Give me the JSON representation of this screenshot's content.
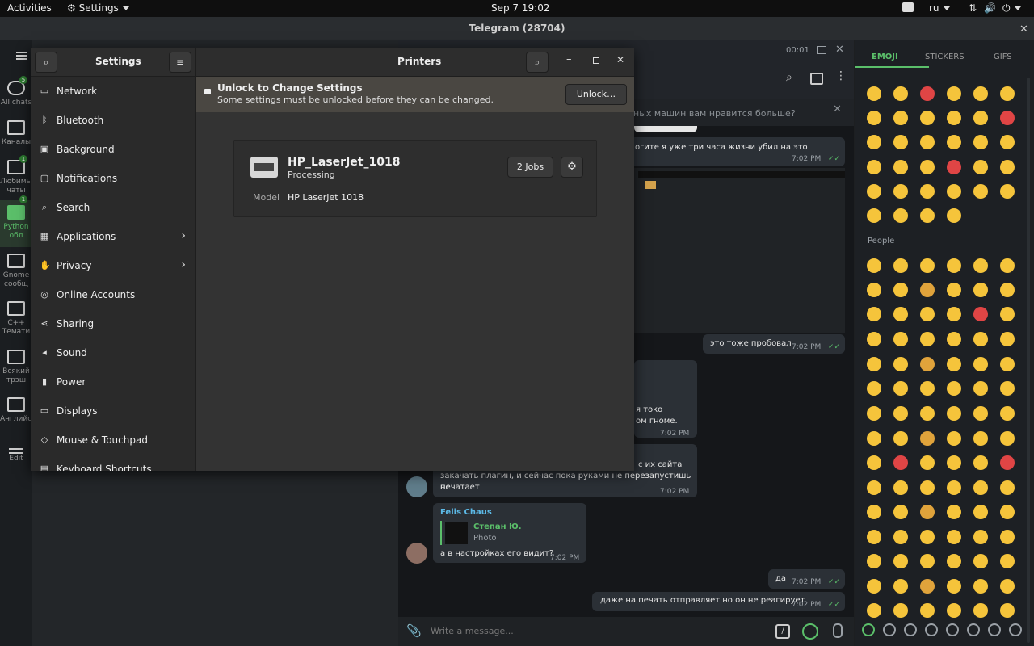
{
  "topbar": {
    "activities": "Activities",
    "app_menu": "Settings",
    "clock": "Sep 7  19:02",
    "lang": "ru"
  },
  "telegram": {
    "title": "Telegram (28704)",
    "folders": [
      {
        "label": "All chats",
        "badge": "5"
      },
      {
        "label": "Каналы",
        "badge": ""
      },
      {
        "label": "Любимые чаты",
        "badge": "1"
      },
      {
        "label": "Python обл",
        "badge": "1"
      },
      {
        "label": "Gnome сообщ",
        "badge": ""
      },
      {
        "label": "C++ Темати",
        "badge": ""
      },
      {
        "label": "Всякий трэш",
        "badge": ""
      },
      {
        "label": "Английский",
        "badge": ""
      },
      {
        "label": "Edit",
        "badge": ""
      }
    ],
    "call_timer": "00:01",
    "pinned_text": "ных машин вам нравится больше?",
    "messages": {
      "m1_text": "огите я уже три часа жизни убил на это",
      "m1_time": "7:02 PM",
      "m2_text": "это тоже пробовал",
      "m2_time": "7:02 PM",
      "m3_text_a": "я токо",
      "m3_text_b": "ом гноме.",
      "m3_time": "7:02 PM",
      "m4_text_a": "с их сайта",
      "m4_text_b": "закачать плагин, и сейчас пока руками не перезапустишь не",
      "m4_text_c": "печатает",
      "m4_time": "7:02 PM",
      "m5_sender": "Felis Chaus",
      "m5_reply_name": "Степан Ю.",
      "m5_reply_text": "Photo",
      "m5_text": "а в настройках его видит?",
      "m5_time": "7:02 PM",
      "m6_text": "да",
      "m6_time": "7:02 PM",
      "m7_text": "даже на печать отправляет но он не реагирует",
      "m7_time": "7:02 PM"
    },
    "composer_placeholder": "Write a message...",
    "emoji_tabs": [
      "EMOJI",
      "STICKERS",
      "GIFS"
    ],
    "people_label": "People"
  },
  "settings": {
    "sidebar_title": "Settings",
    "panel_title": "Printers",
    "sidebar_items": [
      {
        "label": "Network",
        "icon": "network-icon",
        "chevron": false
      },
      {
        "label": "Bluetooth",
        "icon": "bluetooth-icon",
        "chevron": false
      },
      {
        "label": "Background",
        "icon": "background-icon",
        "chevron": false
      },
      {
        "label": "Notifications",
        "icon": "notifications-icon",
        "chevron": false
      },
      {
        "label": "Search",
        "icon": "search-icon",
        "chevron": false
      },
      {
        "label": "Applications",
        "icon": "applications-icon",
        "chevron": true
      },
      {
        "label": "Privacy",
        "icon": "privacy-icon",
        "chevron": true
      },
      {
        "label": "Online Accounts",
        "icon": "online-accounts-icon",
        "chevron": false
      },
      {
        "label": "Sharing",
        "icon": "sharing-icon",
        "chevron": false
      },
      {
        "label": "Sound",
        "icon": "sound-icon",
        "chevron": false
      },
      {
        "label": "Power",
        "icon": "power-icon",
        "chevron": false
      },
      {
        "label": "Displays",
        "icon": "displays-icon",
        "chevron": false
      },
      {
        "label": "Mouse & Touchpad",
        "icon": "mouse-icon",
        "chevron": false
      },
      {
        "label": "Keyboard Shortcuts",
        "icon": "keyboard-icon",
        "chevron": false
      }
    ],
    "infobar": {
      "title": "Unlock to Change Settings",
      "subtitle": "Some settings must be unlocked before they can be changed.",
      "button": "Unlock…"
    },
    "printer": {
      "name": "HP_LaserJet_1018",
      "status": "Processing",
      "jobs_button": "2 Jobs",
      "model_label": "Model",
      "model_value": "HP LaserJet 1018"
    }
  }
}
